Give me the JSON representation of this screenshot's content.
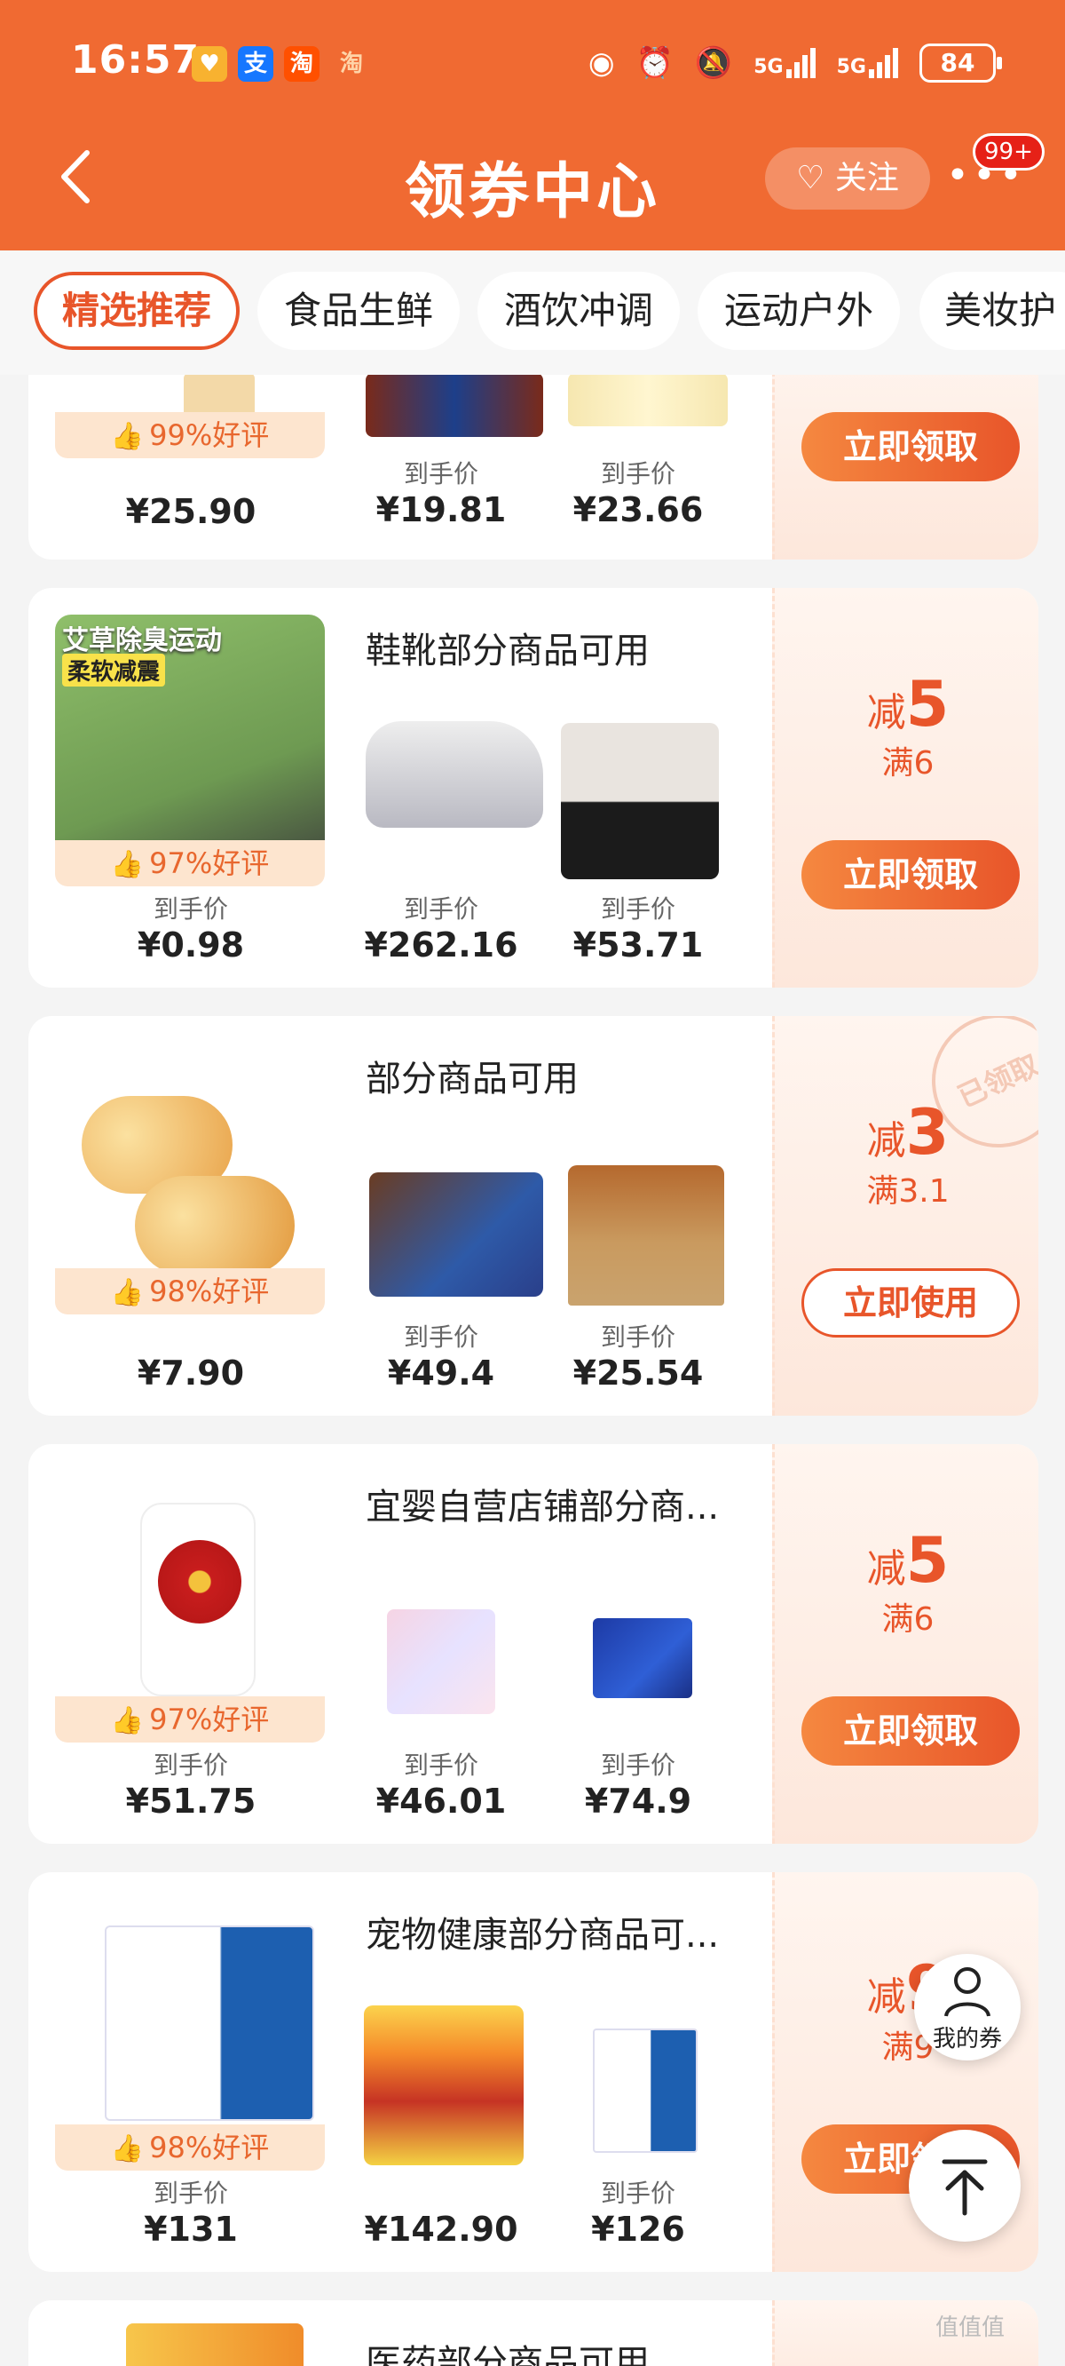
{
  "status_bar": {
    "time": "16:57",
    "app_icons": [
      "heart-shield-icon",
      "alipay-icon",
      "taobao-icon",
      "taobao-mini-icon"
    ],
    "icons": [
      "eye-icon",
      "alarm-icon",
      "mute-icon"
    ],
    "net1": "5G",
    "net2": "5G",
    "battery": "84"
  },
  "header": {
    "title": "领券中心",
    "follow_label": "关注",
    "more_badge": "99+"
  },
  "tabs": [
    "精选推荐",
    "食品生鲜",
    "酒饮冲调",
    "运动户外",
    "美妆护"
  ],
  "price_label": "到手价",
  "coupons": [
    {
      "desc": "",
      "rating": "99%好评",
      "prices": [
        "¥25.90",
        "¥19.81",
        "¥23.66"
      ],
      "amount": "",
      "threshold": "",
      "button": "立即领取",
      "claimed": false
    },
    {
      "desc": "鞋靴部分商品可用",
      "promo": "艾草除臭运动",
      "promo_sub": "柔软减震",
      "rating": "97%好评",
      "prices": [
        "¥0.98",
        "¥262.16",
        "¥53.71"
      ],
      "amount": "5",
      "threshold": "满6",
      "button": "立即领取",
      "claimed": false
    },
    {
      "desc": "部分商品可用",
      "rating": "98%好评",
      "prices": [
        "¥7.90",
        "¥49.4",
        "¥25.54"
      ],
      "amount": "3",
      "threshold": "满3.1",
      "button": "立即使用",
      "claimed": true,
      "stamp": "已领取"
    },
    {
      "desc": "宜婴自营店铺部分商...",
      "rating": "97%好评",
      "prices": [
        "¥51.75",
        "¥46.01",
        "¥74.9"
      ],
      "amount": "5",
      "threshold": "满6",
      "button": "立即领取",
      "claimed": false
    },
    {
      "desc": "宠物健康部分商品可...",
      "rating": "98%好评",
      "prices": [
        "¥131",
        "¥142.90",
        "¥126"
      ],
      "amount": "9",
      "threshold": "满9",
      "button": "立即领取",
      "claimed": false
    },
    {
      "desc": "医药部分商品可用"
    }
  ],
  "decrease_word": "减",
  "float_coupon_label": "我的券",
  "watermark": "值值值"
}
